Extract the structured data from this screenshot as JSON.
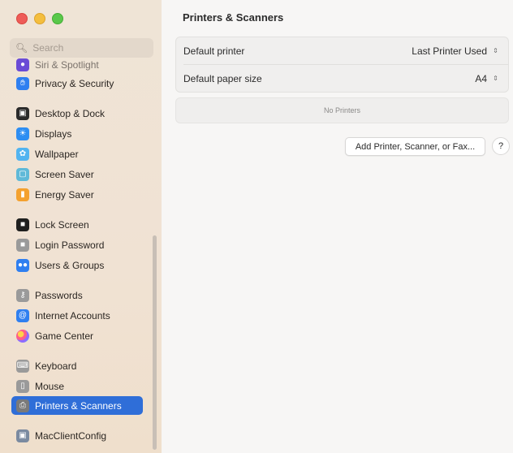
{
  "window": {
    "traffic_lights": [
      "close",
      "minimize",
      "zoom"
    ]
  },
  "sidebar": {
    "search_placeholder": "Search",
    "items": [
      {
        "label": "Siri & Spotlight",
        "icon": "siri-icon",
        "color": "#6a4bd6"
      },
      {
        "label": "Privacy & Security",
        "icon": "hand-icon",
        "color": "#2f7ff0"
      },
      {
        "label": "Desktop & Dock",
        "icon": "dock-icon",
        "color": "#2a2a2a"
      },
      {
        "label": "Displays",
        "icon": "sun-icon",
        "color": "#2e8ef2"
      },
      {
        "label": "Wallpaper",
        "icon": "wallpaper-icon",
        "color": "#52b4f0"
      },
      {
        "label": "Screen Saver",
        "icon": "screensaver-icon",
        "color": "#5fb9d8"
      },
      {
        "label": "Energy Saver",
        "icon": "battery-icon",
        "color": "#f4a12f"
      },
      {
        "label": "Lock Screen",
        "icon": "lock-icon",
        "color": "#1f1f1f"
      },
      {
        "label": "Login Password",
        "icon": "lock-icon",
        "color": "#9a9a9a"
      },
      {
        "label": "Users & Groups",
        "icon": "users-icon",
        "color": "#2f7ff0"
      },
      {
        "label": "Passwords",
        "icon": "key-icon",
        "color": "#9a9a9a"
      },
      {
        "label": "Internet Accounts",
        "icon": "at-icon",
        "color": "#2f7ff0"
      },
      {
        "label": "Game Center",
        "icon": "game-center-icon",
        "color": "#ff5e8a"
      },
      {
        "label": "Keyboard",
        "icon": "keyboard-icon",
        "color": "#9a9a9a"
      },
      {
        "label": "Mouse",
        "icon": "mouse-icon",
        "color": "#9a9a9a"
      },
      {
        "label": "Printers & Scanners",
        "icon": "printer-icon",
        "color": "#7a7a7a"
      },
      {
        "label": "MacClientConfig",
        "icon": "config-icon",
        "color": "#7a8aa0"
      }
    ],
    "selected_label": "Printers & Scanners",
    "accent_color": "#2f6ed8"
  },
  "main": {
    "title": "Printers & Scanners",
    "default_printer_label": "Default printer",
    "default_printer_value": "Last Printer Used",
    "default_paper_label": "Default paper size",
    "default_paper_value": "A4",
    "no_printers_text": "No Printers",
    "add_button_label": "Add Printer, Scanner, or Fax...",
    "help_label": "?"
  }
}
